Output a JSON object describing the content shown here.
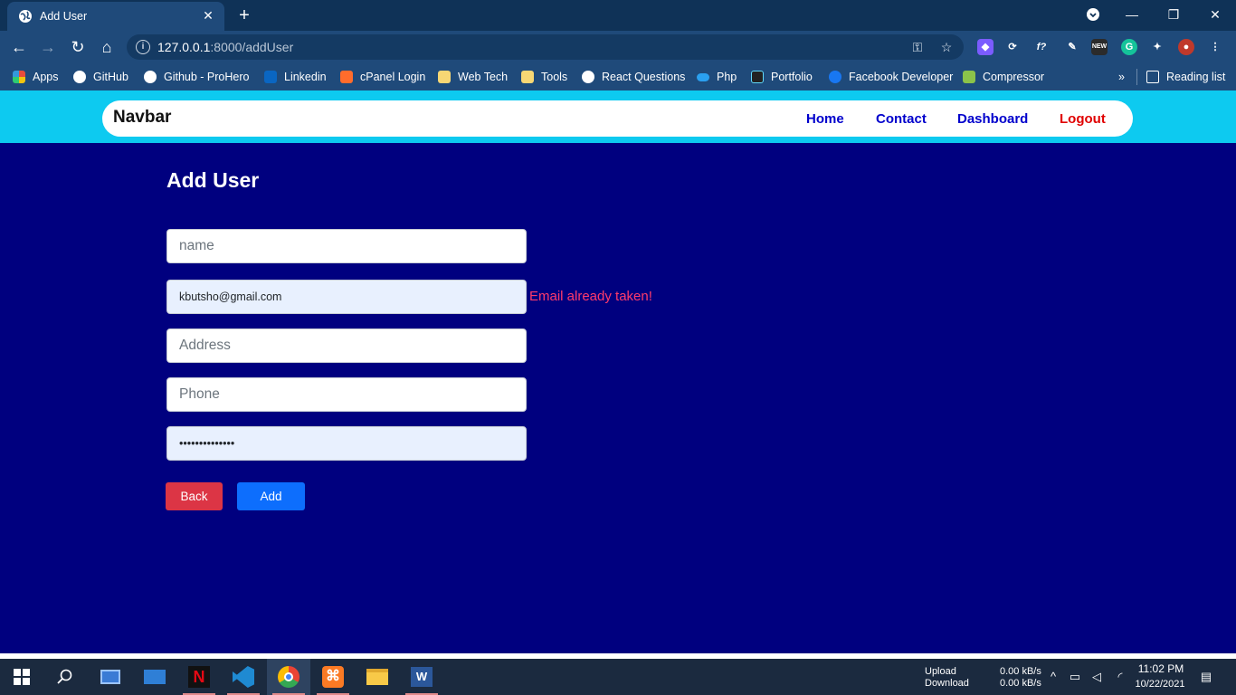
{
  "browser": {
    "tab_title": "Add User",
    "url_host": "127.0.0.1",
    "url_path": ":8000/addUser",
    "bookmarks": [
      {
        "label": "Apps",
        "icon": "apps-grid-icon"
      },
      {
        "label": "GitHub",
        "icon": "github-icon"
      },
      {
        "label": "Github - ProHero",
        "icon": "github-icon"
      },
      {
        "label": "Linkedin",
        "icon": "linkedin-icon"
      },
      {
        "label": "cPanel Login",
        "icon": "cpanel-icon"
      },
      {
        "label": "Web Tech",
        "icon": "folder-icon"
      },
      {
        "label": "Tools",
        "icon": "folder-icon"
      },
      {
        "label": "React Questions",
        "icon": "github-icon"
      },
      {
        "label": "Php",
        "icon": "onedrive-icon"
      },
      {
        "label": "Portfolio",
        "icon": "react-icon"
      },
      {
        "label": "Facebook Developer",
        "icon": "facebook-icon"
      },
      {
        "label": "Compressor",
        "icon": "compressor-icon"
      }
    ],
    "more_label": "»",
    "reading_list_label": "Reading list"
  },
  "navbar": {
    "brand": "Navbar",
    "links": [
      "Home",
      "Contact",
      "Dashboard",
      "Logout"
    ]
  },
  "form": {
    "title": "Add User",
    "name_placeholder": "name",
    "email_value": "kbutsho@gmail.com",
    "email_error": "Email already taken!",
    "address_placeholder": "Address",
    "phone_placeholder": "Phone",
    "password_value": "••••••••••••••",
    "back_label": "Back",
    "add_label": "Add"
  },
  "taskbar": {
    "upload_label": "Upload",
    "download_label": "Download",
    "upload_speed": "0.00 kB/s",
    "download_speed": "0.00 kB/s",
    "time": "11:02 PM",
    "date": "10/22/2021"
  },
  "colors": {
    "page_bg": "#00007f",
    "navbar_bg": "#0dcaf0",
    "link": "#0000cc",
    "logout": "#e00000",
    "error": "#ff3b6b",
    "back_button": "#dc3545",
    "add_button": "#0d6efd"
  }
}
